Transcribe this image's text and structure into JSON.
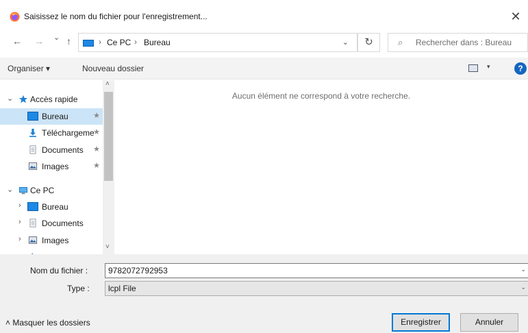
{
  "window": {
    "title": "Saisissez le nom du fichier pour l'enregistrement...",
    "close_glyph": "✕",
    "app_icon": "firefox-icon"
  },
  "nav": {
    "back_glyph": "←",
    "forward_glyph": "→",
    "recent_glyph": "⌄",
    "up_glyph": "↑",
    "breadcrumb": [
      "Ce PC",
      "Bureau"
    ],
    "crumb_sep": "›",
    "dropdown_glyph": "⌄",
    "refresh_glyph": "↻",
    "search_glyph": "⌕",
    "search_placeholder": "Rechercher dans : Bureau"
  },
  "toolbar": {
    "organize_label": "Organiser ▾",
    "new_folder_label": "Nouveau dossier",
    "view_caret": "▾",
    "help_label": "?"
  },
  "sidebar": {
    "quick_access": {
      "chevron": "⌄",
      "label": "Accès rapide",
      "icon": "star-icon"
    },
    "quick_items": [
      {
        "label": "Bureau",
        "icon": "desktop-icon",
        "pinned": "★"
      },
      {
        "label": "Téléchargeme",
        "icon": "download-icon",
        "pinned": "★"
      },
      {
        "label": "Documents",
        "icon": "document-icon",
        "pinned": "★"
      },
      {
        "label": "Images",
        "icon": "image-icon",
        "pinned": "★"
      }
    ],
    "this_pc": {
      "chevron": "⌄",
      "label": "Ce PC",
      "icon": "computer-icon"
    },
    "pc_items": [
      {
        "chevron": "›",
        "label": "Bureau",
        "icon": "desktop-icon"
      },
      {
        "chevron": "›",
        "label": "Documents",
        "icon": "document-icon"
      },
      {
        "chevron": "›",
        "label": "Images",
        "icon": "image-icon"
      }
    ],
    "scroll_up": "˄",
    "scroll_down": "˅"
  },
  "content": {
    "empty_message": "Aucun élément ne correspond à votre recherche."
  },
  "form": {
    "filename_label": "Nom du fichier :",
    "filename_value": "9782072792953",
    "type_label": "Type :",
    "type_value": "lcpl File",
    "caret": "⌄"
  },
  "footer": {
    "toggle_label": "˄  Masquer les dossiers",
    "save_label": "Enregistrer",
    "cancel_label": "Annuler"
  },
  "colors": {
    "selection": "#cce4f7",
    "accent": "#0078d7",
    "help": "#1565c0",
    "lower_panel": "#f0f0f0"
  }
}
